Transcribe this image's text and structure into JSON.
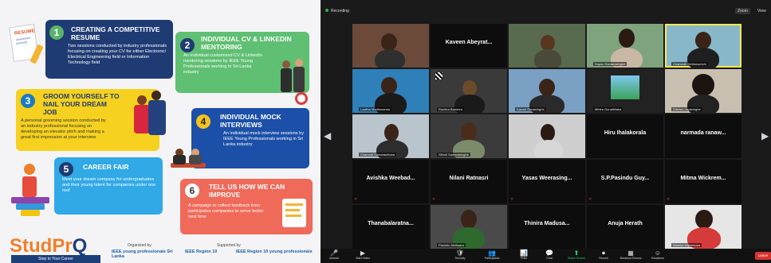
{
  "poster": {
    "cards": [
      {
        "num": "1",
        "title": "CREATING A COMPETITIVE RESUME",
        "desc": "Two sessions conducted by industry professionals focusing on creating your CV for either Electronic/ Electrical Engineering field or Information Technology field"
      },
      {
        "num": "2",
        "title": "INDIVIDUAL CV & LINKEDIN MENTORING",
        "desc": "An individual customized CV & LinkedIn mentoring sessions by IEEE Young Professionals working in Sri Lanka industry"
      },
      {
        "num": "3",
        "title": "GROOM YOURSELF TO NAIL YOUR DREAM JOB",
        "desc": "A personal grooming session conducted by an industry professional focusing on developing an elevator pitch and making a great first impression at your interview"
      },
      {
        "num": "4",
        "title": "INDIVIDUAL MOCK INTERVIEWS",
        "desc": "An individual mock interview sessions by IEEE Young Professionals working in Sri Lanka industry"
      },
      {
        "num": "5",
        "title": "CAREER FAIR",
        "desc": "Meet your dream company for undergraduates and their young talent for companies under one roof"
      },
      {
        "num": "6",
        "title": "TELL US HOW WE CAN IMPROVE",
        "desc": "A campaign to collect feedback from participates companies to serve better next time"
      }
    ],
    "resume_label": "RESUME",
    "logo_a": "StudPr",
    "logo_b": "Q",
    "tagline": "Step to Your Career",
    "organized_by": "Organized by",
    "org1": "IEEE young professionals Sri Lanka",
    "supported_by": "Supported by",
    "sup1": "IEEE Region 10",
    "sup2": "IEEE Region 10 young professionals"
  },
  "zoom": {
    "recording": "Recording",
    "zoom_level": "Zoom",
    "view": "View",
    "tiles": [
      {
        "name": "",
        "label": ""
      },
      {
        "name": "Kaveen Abeyrat...",
        "label": ""
      },
      {
        "name": "",
        "label": ""
      },
      {
        "name": "",
        "label": "Supun Samarasinghe"
      },
      {
        "name": "",
        "label": "Chamodh Hettiarachchi"
      },
      {
        "name": "",
        "label": ""
      },
      {
        "name": "",
        "label": "Lasitha Madhusanka"
      },
      {
        "name": "",
        "label": "Ruchira Bandara"
      },
      {
        "name": "",
        "label": "Kasuni Ranasinghe"
      },
      {
        "name": "",
        "label": "Mihira Gunathilaka"
      },
      {
        "name": "",
        "label": "Dilshan Jayasinghe"
      },
      {
        "name": "",
        "label": ""
      },
      {
        "name": "",
        "label": "Chamodi Samarasekara"
      },
      {
        "name": "",
        "label": "Sithuli Samarasinghe"
      },
      {
        "name": "",
        "label": ""
      },
      {
        "name": "Hiru Ihalakorala",
        "label": ""
      },
      {
        "name": "narmada ranaw...",
        "label": ""
      },
      {
        "name": "Avishka Weebad...",
        "label": ""
      },
      {
        "name": "Nilani Ratnasri",
        "label": ""
      },
      {
        "name": "Yasas Weerasing...",
        "label": ""
      },
      {
        "name": "S.P.Pasindu Guy...",
        "label": ""
      },
      {
        "name": "Mitma Wickrem...",
        "label": ""
      },
      {
        "name": "Thanabalaratna...",
        "label": ""
      },
      {
        "name": "",
        "label": "Pasindu Nethsara"
      },
      {
        "name": "Thinira Madusa...",
        "label": ""
      },
      {
        "name": "Anuja Herath",
        "label": ""
      },
      {
        "name": "",
        "label": "Nilanka Wijesekara"
      }
    ],
    "toolbar": [
      {
        "icon": "🎤",
        "label": "Unmute"
      },
      {
        "icon": "▶",
        "label": "Start Video"
      },
      {
        "icon": "🛡",
        "label": "Security"
      },
      {
        "icon": "👥",
        "label": "Participants"
      },
      {
        "icon": "📊",
        "label": "Polls"
      },
      {
        "icon": "💬",
        "label": "Chat"
      },
      {
        "icon": "⬆",
        "label": "Share Screen"
      },
      {
        "icon": "⏺",
        "label": "Record"
      },
      {
        "icon": "▦",
        "label": "Breakout Rooms"
      },
      {
        "icon": "☺",
        "label": "Reactions"
      }
    ],
    "end_label": "Leave"
  }
}
